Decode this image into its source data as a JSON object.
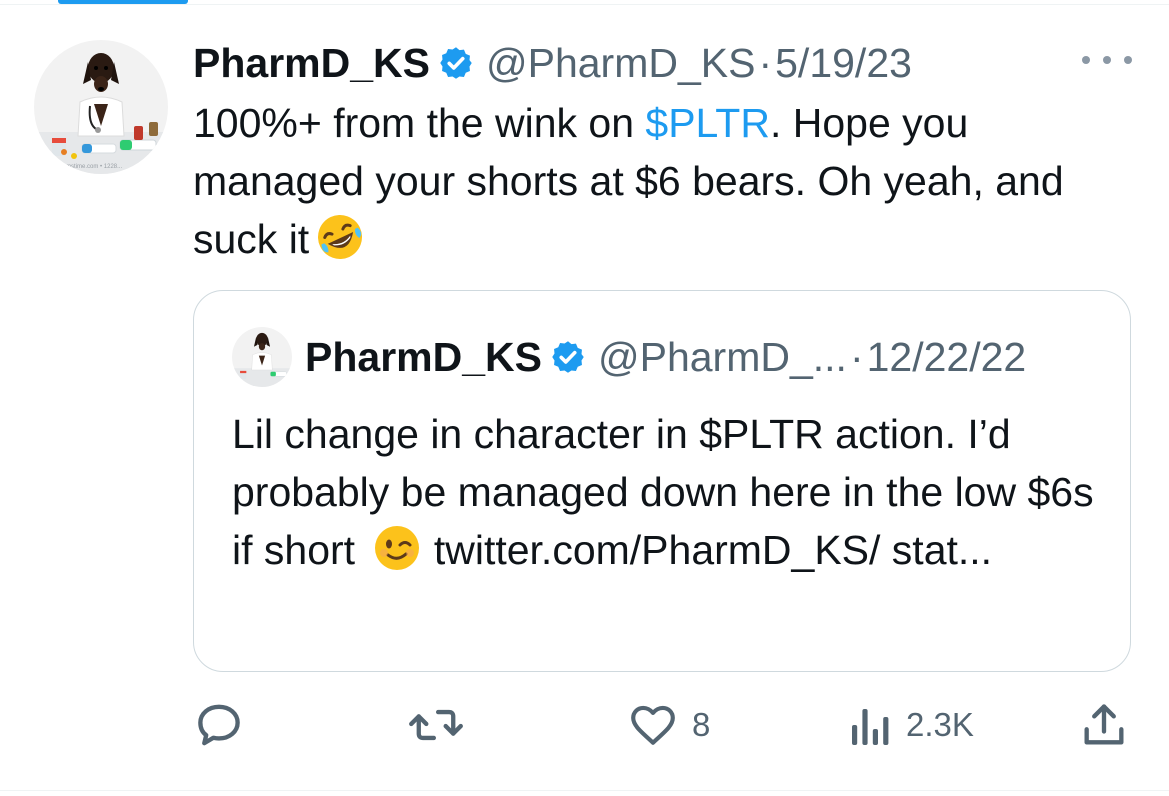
{
  "tweet": {
    "author_name": "PharmD_KS",
    "handle": "@PharmD_KS",
    "separator": "·",
    "date": "5/19/23",
    "text_before_cashtag": "100%+ from the wink on ",
    "cashtag": "$PLTR",
    "text_after_cashtag": ". Hope you managed your shorts at $6 bears. Oh yeah, and suck it",
    "emoji": "rolling-on-the-floor-laughing-emoji",
    "avatar_watermark": "dreamstime.com • 1228..."
  },
  "quoted_tweet": {
    "author_name": "PharmD_KS",
    "handle": "@PharmD_...",
    "separator": "·",
    "date": "12/22/22",
    "text_before_emoji": "Lil change in character in $PLTR action. I’d probably be managed down here in the low $6s if short",
    "emoji": "winking-face-emoji",
    "text_after_emoji": " twitter.com/PharmD_KS/ stat..."
  },
  "actions": {
    "reply_icon": "reply-icon",
    "retweet_icon": "retweet-icon",
    "like_icon": "heart-icon",
    "like_count": "8",
    "views_icon": "views-icon",
    "views_count": "2.3K",
    "share_icon": "share-icon"
  },
  "colors": {
    "accent": "#1d9bf0",
    "text": "#0f1419",
    "secondary": "#536471",
    "border": "#cfd9de"
  }
}
